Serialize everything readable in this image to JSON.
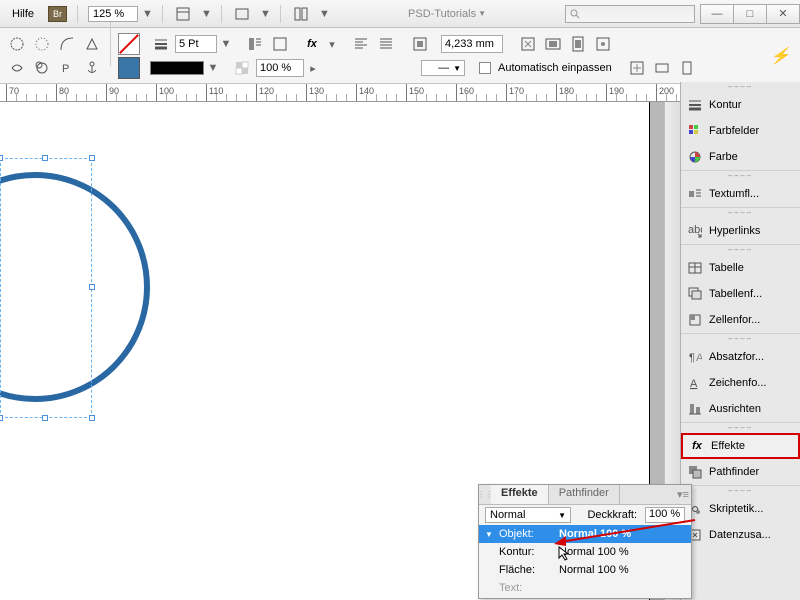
{
  "titlebar": {
    "help": "Hilfe",
    "br": "Br",
    "zoom": "125 %",
    "workspace": "PSD-Tutorials"
  },
  "control": {
    "stroke_weight": "5 Pt",
    "opacity": "100 %",
    "dim": "4,233 mm",
    "autofit": "Automatisch einpassen",
    "fx": "fx"
  },
  "ruler": {
    "marks": [
      70,
      80,
      90,
      100,
      110,
      120,
      130,
      140,
      150,
      160,
      170,
      180,
      190,
      200
    ]
  },
  "panels": {
    "kontur": "Kontur",
    "farbfelder": "Farbfelder",
    "farbe": "Farbe",
    "textumfl": "Textumfl...",
    "hyperlinks": "Hyperlinks",
    "tabelle": "Tabelle",
    "tabellenf": "Tabellenf...",
    "zellenfor": "Zellenfor...",
    "absatzfor": "Absatzfor...",
    "zeichenfo": "Zeichenfo...",
    "ausrichten": "Ausrichten",
    "effekte": "Effekte",
    "pathfinder": "Pathfinder",
    "skriptetik": "Skriptetik...",
    "datenzusa": "Datenzusa..."
  },
  "effects_panel": {
    "tab_effekte": "Effekte",
    "tab_pathfinder": "Pathfinder",
    "blend_mode": "Normal",
    "opacity_label": "Deckkraft:",
    "opacity_value": "100 %",
    "rows": {
      "objekt_label": "Objekt:",
      "objekt_value": "Normal 100 %",
      "kontur_label": "Kontur:",
      "kontur_value": "Normal 100 %",
      "flaeche_label": "Fläche:",
      "flaeche_value": "Normal 100 %",
      "text_label": "Text:"
    }
  }
}
